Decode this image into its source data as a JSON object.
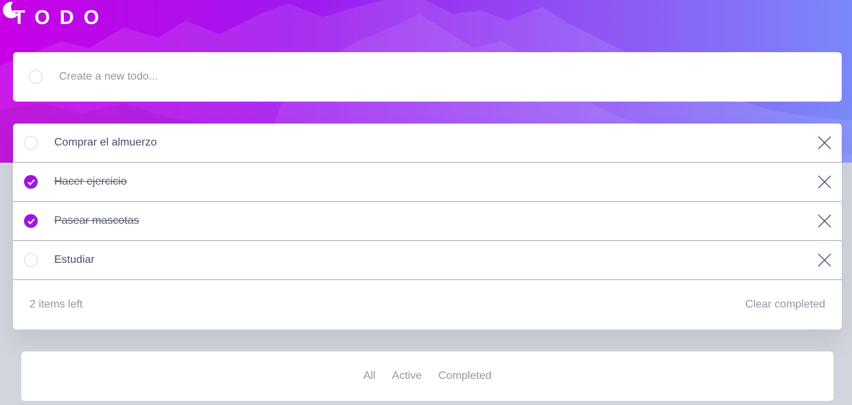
{
  "header": {
    "title": "TODO",
    "theme_icon": "moon-icon"
  },
  "new_todo": {
    "placeholder": "Create a new todo...",
    "value": ""
  },
  "todos": [
    {
      "text": "Comprar el almuerzo",
      "completed": false
    },
    {
      "text": "Hacer ejercicio",
      "completed": true
    },
    {
      "text": "Pasear mascotas",
      "completed": true
    },
    {
      "text": "Estudiar",
      "completed": false
    }
  ],
  "footer": {
    "items_left": "2 items left",
    "clear_label": "Clear completed"
  },
  "filters": {
    "all": "All",
    "active": "Active",
    "completed": "Completed"
  },
  "colors": {
    "accent_start": "#c800e6",
    "accent_end": "#7a88f8",
    "page_bg": "#d2d5dd"
  }
}
